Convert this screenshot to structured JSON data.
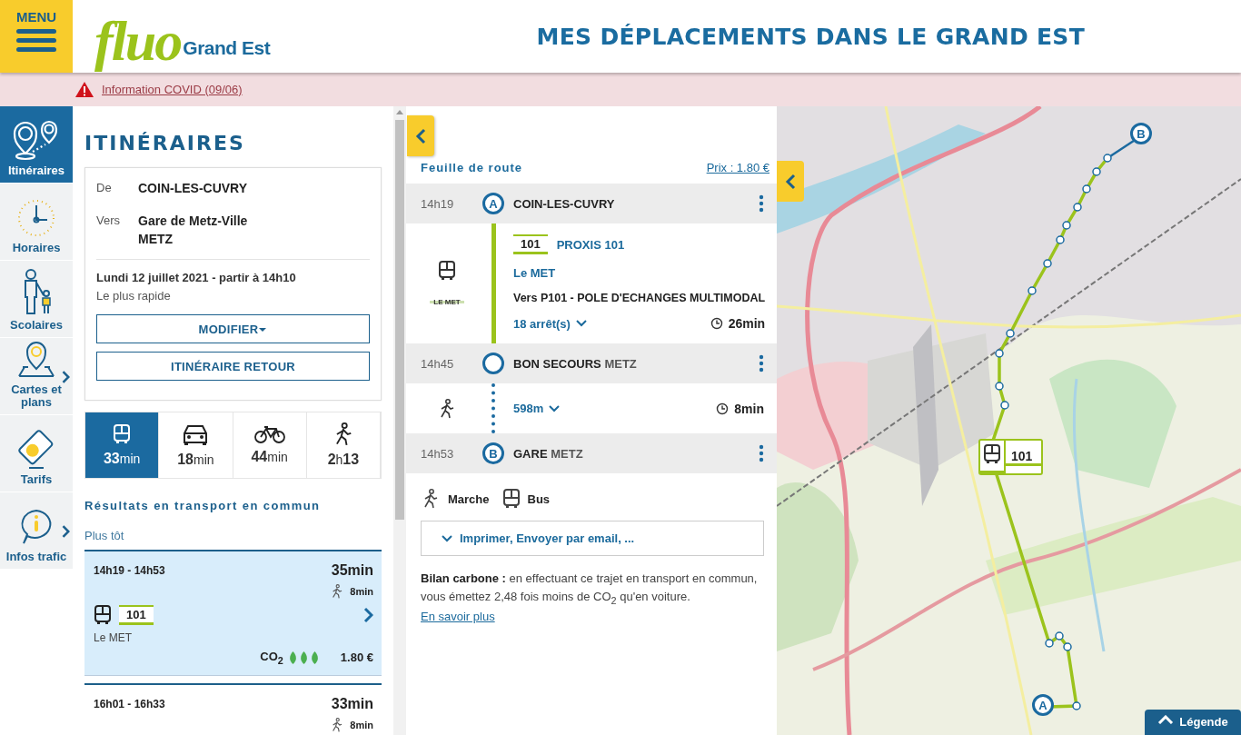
{
  "header": {
    "menu_label": "MENU",
    "logo_main": "fluo",
    "logo_sub": "Grand Est",
    "title": "MES DÉPLACEMENTS DANS LE GRAND EST"
  },
  "alert": {
    "text": "Information COVID (09/06)"
  },
  "sidebar": {
    "items": [
      {
        "kind": "route",
        "label": "Itinéraires",
        "selected": true,
        "submenu": false
      },
      {
        "kind": "clock",
        "label": "Horaires",
        "selected": false,
        "submenu": false
      },
      {
        "kind": "pupil",
        "label": "Scolaires",
        "selected": false,
        "submenu": false
      },
      {
        "kind": "map",
        "label": "Cartes et plans",
        "selected": false,
        "submenu": true
      },
      {
        "kind": "ticket",
        "label": "Tarifs",
        "selected": false,
        "submenu": false
      },
      {
        "kind": "info",
        "label": "Infos trafic",
        "selected": false,
        "submenu": true
      }
    ]
  },
  "planner": {
    "title": "ITINÉRAIRES",
    "from_label": "De",
    "from": "COIN-LES-CUVRY",
    "to_label": "Vers",
    "to": "Gare de Metz-Ville",
    "to_city": "METZ",
    "date": "Lundi 12 juillet 2021 -  partir à 14h10",
    "preference": "Le plus rapide",
    "buttons": [
      {
        "label": "MODIFIER",
        "dropdown": true
      },
      {
        "label": "ITINÉRAIRE RETOUR",
        "dropdown": false
      }
    ]
  },
  "modes": [
    {
      "kind": "bus",
      "duration": "**33**min",
      "selected": true
    },
    {
      "kind": "car",
      "duration": "**18**min",
      "selected": false
    },
    {
      "kind": "bike",
      "duration": "**44**min",
      "selected": false
    },
    {
      "kind": "walk",
      "duration": "**2**h**13**",
      "selected": false
    }
  ],
  "results": {
    "title": "Résultats en transport en commun",
    "earlier": "Plus tôt",
    "items": [
      {
        "times": "14h19  -  14h53",
        "duration": "35min",
        "walk": "8min",
        "line": "101",
        "operator": "Le MET",
        "co2": "CO$_{2}$",
        "stars": 3,
        "price": "1.80 €",
        "selected": true
      },
      {
        "times": "16h01  -  16h33",
        "duration": "33min",
        "walk": "8min",
        "selected": false
      }
    ]
  },
  "roadmap": {
    "title": "Feuille de route",
    "price_link": "Prix : 1.80 €",
    "steps": [
      {
        "kind": "stop",
        "time": "14h19",
        "marker": "A",
        "name": "COIN-LES-CUVRY"
      },
      {
        "kind": "bus",
        "line": "101",
        "line_name": "PROXIS 101",
        "operator": "Le MET",
        "operator_logo": "LE MET",
        "direction": "Vers P101 - POLE D'ECHANGES MULTIMODAL",
        "stops": "18 arrêt(s)",
        "duration": "26min"
      },
      {
        "kind": "stop",
        "time": "14h45",
        "name": "BON SECOURS",
        "city": "METZ"
      },
      {
        "kind": "walk",
        "distance": "598m",
        "duration": "8min"
      },
      {
        "kind": "stop",
        "time": "14h53",
        "marker": "B",
        "name": "GARE",
        "city": "METZ"
      }
    ],
    "legend": [
      {
        "kind": "walk",
        "label": "Marche"
      },
      {
        "kind": "bus",
        "label": "Bus"
      }
    ],
    "share": "Imprimer, Envoyer par email, ...",
    "carbon": "**Bilan carbone :** en effectuant ce trajet en transport en commun, vous émettez 2,48 fois moins de CO$_{2}$ qu'en voiture.",
    "learn_more": "En savoir plus"
  },
  "map": {
    "kind": "picture",
    "line_badge": "101",
    "start_marker": "A",
    "end_marker": "B",
    "legend_button": "Légende"
  }
}
